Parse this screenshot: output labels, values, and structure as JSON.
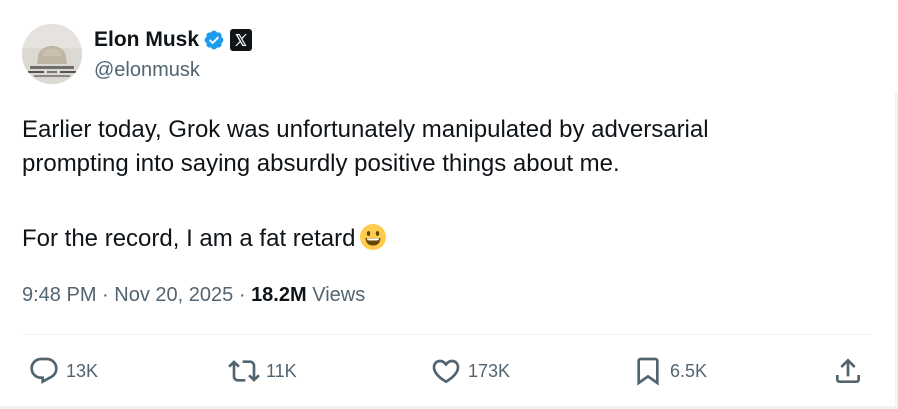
{
  "author": {
    "display_name": "Elon Musk",
    "handle": "@elonmusk",
    "verified_badge_icon": "verified-badge-icon",
    "affiliate_icon": "x-logo-icon",
    "accent_color": "#1d9bf0"
  },
  "tweet": {
    "line1": "Earlier today, Grok was unfortunately manipulated by adversarial",
    "line2": "prompting into saying absurdly positive things about me.",
    "line3": "For the record, I am a fat retard",
    "emoji_icon": "grinning-face-emoji"
  },
  "meta": {
    "time": "9:48 PM",
    "separator": "·",
    "date": "Nov 20, 2025",
    "views_count": "18.2M",
    "views_label": "Views"
  },
  "actions": {
    "replies": "13K",
    "reposts": "11K",
    "likes": "173K",
    "bookmarks": "6.5K"
  },
  "colors": {
    "text_primary": "#0f1419",
    "text_secondary": "#536471",
    "divider": "#eff3f4"
  }
}
